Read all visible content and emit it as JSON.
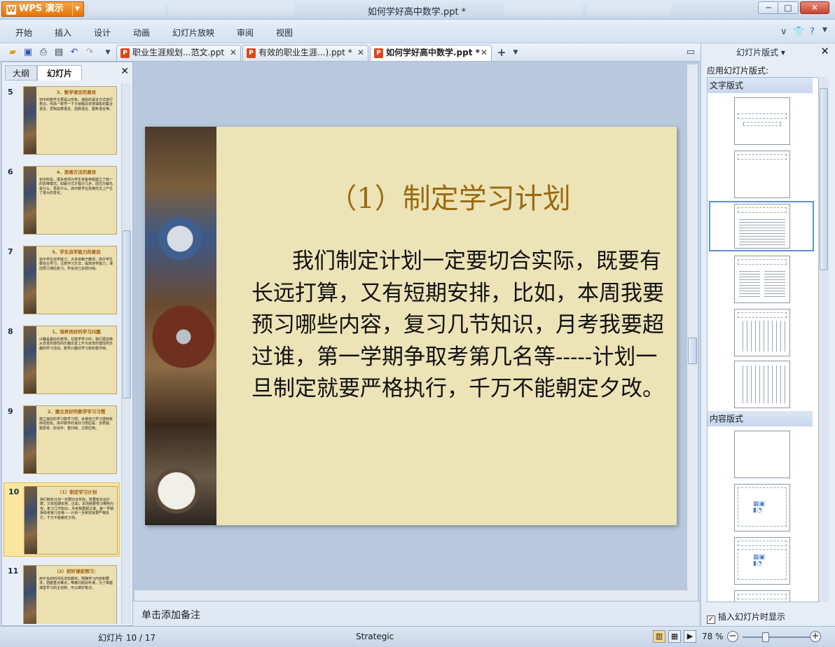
{
  "app": {
    "brand": "WPS 演示",
    "window_title": "如何学好高中数学.ppt *"
  },
  "menu": [
    "开始",
    "插入",
    "设计",
    "动画",
    "幻灯片放映",
    "审阅",
    "视图"
  ],
  "doc_tabs": [
    {
      "label": "职业生涯规划...范文.ppt",
      "active": false
    },
    {
      "label": "有效的职业生涯...).ppt *",
      "active": false
    },
    {
      "label": "如何学好高中数学.ppt *",
      "active": true
    }
  ],
  "left_panel": {
    "tab_outline": "大纲",
    "tab_slides": "幻灯片",
    "thumbnails": [
      {
        "num": "5",
        "title": "3、数学语言的差异",
        "body": "初中的数学主要是以形象、通俗的语言方式进行表达。而高一数学一下子就触及非常抽象的集合语言、逻辑运算语言、函数语言、图象语言等。"
      },
      {
        "num": "6",
        "title": "4、思维方法的差异",
        "body": "初中阶段，很多老师为学生将各种题建立了统一的思维模式，如解分式方程分几步，因式分解先看什么、再看什么。高中数学在思维形式上产生了很大的变化。"
      },
      {
        "num": "7",
        "title": "5、学生自学能力的差异",
        "body": "初中学生自学能力、大多依赖于教师，高中学生要自主学习，注意学习方法，提高自学能力，课前预习课后复习，学会自己总结归纳。"
      },
      {
        "num": "8",
        "title": "1、培养良好的学习兴趣",
        "body": "兴趣是最好的老师。在数学学习中，我们把这种从自发的感性的乐趣出发上升为自觉的理性的乐趣的学习活动，数学兴趣对学习有积极作用。"
      },
      {
        "num": "9",
        "title": "2、建立良好的数学学习习惯",
        "body": "建立良好的学习数学习惯，会使自己学习感到有序而轻松。高中数学的良好习惯应是：多质疑、勤思考、好动手、重归纳、注意应用。"
      },
      {
        "num": "10",
        "title": "（1）制定学习计划",
        "body": "我们制定计划一定要切合实际，既要有长远打算，又有短期安排，比如，本周我要预习哪些内容，复习几节知识，月考我要超过谁，第一学期争取考第几名等-----计划一旦制定就要严格执行，千万不能朝定夕改。"
      },
      {
        "num": "11",
        "title": "（2）抓好课前预习：",
        "body": "用不多的时间先浏览教材，明确学习内容和要求，把握重点难点，带着问题去听课，为了掌握课堂学习的主动权，可以做好笔记。"
      }
    ],
    "selected_num": "10"
  },
  "slide": {
    "title": "（1）制定学习计划",
    "body": "我们制定计划一定要切合实际，既要有长远打算，又有短期安排，比如，本周我要预习哪些内容，复习几节知识，月考我要超过谁，第一学期争取考第几名等-----计划一旦制定就要严格执行，千万不能朝定夕改。"
  },
  "notes_placeholder": "单击添加备注",
  "right_panel": {
    "title": "幻灯片版式",
    "apply_label": "应用幻灯片版式:",
    "section_text": "文字版式",
    "section_content": "内容版式",
    "checkbox_label": "插入幻灯片时显示",
    "checkbox_checked": true
  },
  "status": {
    "slide_position": "幻灯片 10 / 17",
    "theme": "Strategic",
    "zoom": "78 %"
  }
}
